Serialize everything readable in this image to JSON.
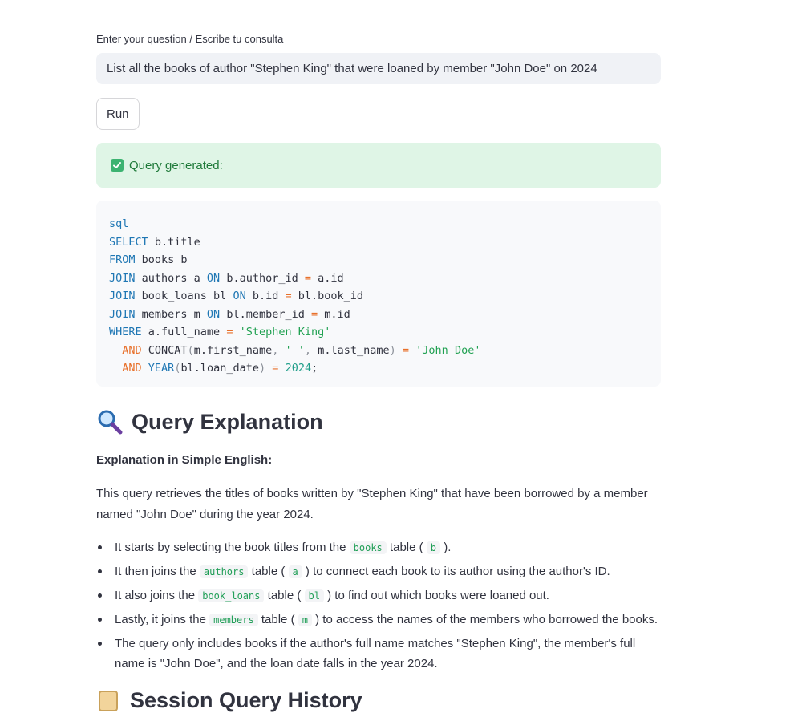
{
  "input": {
    "label": "Enter your question / Escribe tu consulta",
    "value": "List all the books of author \"Stephen King\" that were loaned by member \"John Doe\" on 2024"
  },
  "run_button": {
    "label": "Run"
  },
  "success": {
    "message": "Query generated:"
  },
  "code": {
    "lang": "sql",
    "lines": [
      "SELECT b.title",
      "FROM books b",
      "JOIN authors a ON b.author_id = a.id",
      "JOIN book_loans bl ON b.id = bl.book_id",
      "JOIN members m ON bl.member_id = m.id",
      "WHERE a.full_name = 'Stephen King'",
      "  AND CONCAT(m.first_name, ' ', m.last_name) = 'John Doe'",
      "  AND YEAR(bl.loan_date) = 2024;"
    ]
  },
  "explanation": {
    "heading": "Query Explanation",
    "subheading": "Explanation in Simple English:",
    "paragraph": "This query retrieves the titles of books written by \"Stephen King\" that have been borrowed by a member named \"John Doe\" during the year 2024.",
    "bullets": [
      {
        "pre": "It starts by selecting the book titles from the ",
        "code": "books",
        "mid": " table ( ",
        "alias": "b",
        "post": " )."
      },
      {
        "pre": "It then joins the ",
        "code": "authors",
        "mid": " table ( ",
        "alias": "a",
        "post": " ) to connect each book to its author using the author's ID."
      },
      {
        "pre": "It also joins the ",
        "code": "book_loans",
        "mid": " table ( ",
        "alias": "bl",
        "post": " ) to find out which books were loaned out."
      },
      {
        "pre": "Lastly, it joins the ",
        "code": "members",
        "mid": " table ( ",
        "alias": "m",
        "post": " ) to access the names of the members who borrowed the books."
      },
      {
        "pre": "The query only includes books if the author's full name matches \"Stephen King\", the member's full name is \"John Doe\", and the loan date falls in the year 2024.",
        "code": "",
        "mid": "",
        "alias": "",
        "post": ""
      }
    ]
  },
  "next_section": {
    "heading": "Session Query History"
  },
  "colors": {
    "accent_green": "#1f7a3a",
    "success_bg": "#dff5e6",
    "input_bg": "#f0f2f6",
    "code_bg": "#f8f9fb"
  },
  "icons": {
    "success": "check-box-icon",
    "explanation": "magnifying-glass-icon",
    "history": "scroll-icon"
  }
}
